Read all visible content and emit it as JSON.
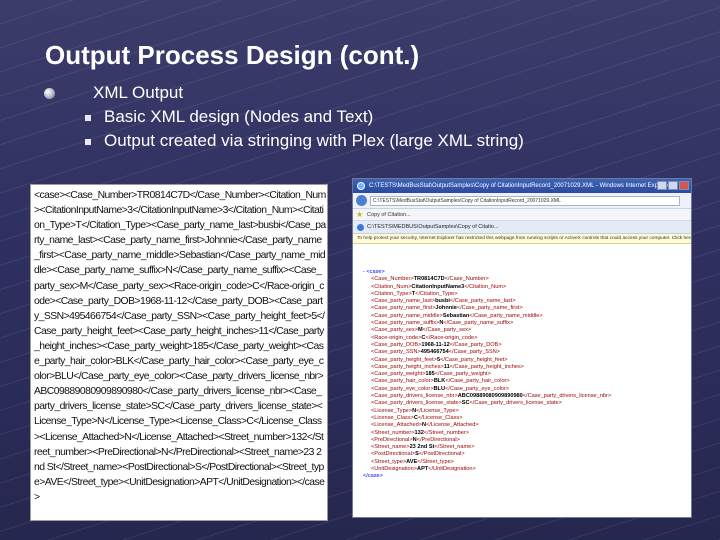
{
  "slide": {
    "title": "Output Process Design (cont.)",
    "bullets": [
      {
        "level": 1,
        "text": "XML Output"
      },
      {
        "level": 2,
        "text": "Basic XML design (Nodes and Text)"
      },
      {
        "level": 2,
        "text": "Output created via stringing with Plex (large XML string)"
      }
    ]
  },
  "raw_xml": {
    "text": "<case><Case_Number>TR0814C7D</Case_Number><Citation_Num><CitationInputName>3</CitationInputName>3</Citation_Num><Citation_Type>T</Citation_Type><Case_party_name_last>busbi</Case_party_name_last><Case_party_name_first>Johnnie</Case_party_name_first><Case_party_name_middle>Sebastian</Case_party_name_middle><Case_party_name_suffix>N</Case_party_name_suffix><Case_party_sex>M</Case_party_sex><Race-origin_code>C</Race-origin_code><Case_party_DOB>1968-11-12</Case_party_DOB><Case_party_SSN>495466754</Case_party_SSN><Case_party_height_feet>5</Case_party_height_feet><Case_party_height_inches>11</Case_party_height_inches><Case_party_weight>185</Case_party_weight><Case_party_hair_color>BLK</Case_party_hair_color><Case_party_eye_color>BLU</Case_party_eye_color><Case_party_drivers_license_nbr>ABC09889080909890980</Case_party_drivers_license_nbr><Case_party_drivers_license_state>SC</Case_party_drivers_license_state><License_Type>N</License_Type><License_Class>C</License_Class><License_Attached>N</License_Attached><Street_number>132</Street_number><PreDirectional>N</PreDirectional><Street_name>23 2nd St</Street_name><PostDirectional>S</PostDirectional><Street_type>AVE</Street_type><UnitDesignation>APT</UnitDesignation></case>"
  },
  "browser": {
    "window_title": "C:\\TESTS\\MedBusStat\\OutputSamples\\Copy of CitationInputRecord_20071029.XML - Windows Internet Explorer",
    "address": "C:\\TESTS\\MedBusStat\\OutputSamples\\Copy of CitationInputRecord_20071029.XML",
    "tab_label": "Copy of Citation...",
    "second_window_title": "C:\\TESTS\\MEDBUS\\OutputSamples\\Copy of Citatio...",
    "infobar": "To help protect your security, Internet Explorer has restricted this webpage from running scripts or ActiveX controls that could access your computer. Click here for options...",
    "xml_root_open": "- <case>",
    "xml_root_close": "</case>",
    "xml_lines": [
      {
        "tag": "Case_Number",
        "value": "TR0814C7D"
      },
      {
        "tag": "Citation_Num",
        "value": "CitationInputName3"
      },
      {
        "tag": "Citation_Type",
        "value": "T"
      },
      {
        "tag": "Case_party_name_last",
        "value": "busbi"
      },
      {
        "tag": "Case_party_name_first",
        "value": "Johnnie"
      },
      {
        "tag": "Case_party_name_middle",
        "value": "Sebastian"
      },
      {
        "tag": "Case_party_name_suffix",
        "value": "N"
      },
      {
        "tag": "Case_party_sex",
        "value": "M"
      },
      {
        "tag": "Race-origin_code",
        "value": "C"
      },
      {
        "tag": "Case_party_DOB",
        "value": "1968-11-12"
      },
      {
        "tag": "Case_party_SSN",
        "value": "495466754"
      },
      {
        "tag": "Case_party_height_feet",
        "value": "5"
      },
      {
        "tag": "Case_party_height_inches",
        "value": "11"
      },
      {
        "tag": "Case_party_weight",
        "value": "185"
      },
      {
        "tag": "Case_party_hair_color",
        "value": "BLK"
      },
      {
        "tag": "Case_party_eye_color",
        "value": "BLU"
      },
      {
        "tag": "Case_party_drivers_license_nbr",
        "value": "ABC09889080909890980"
      },
      {
        "tag": "Case_party_drivers_license_state",
        "value": "SC"
      },
      {
        "tag": "License_Type",
        "value": "N"
      },
      {
        "tag": "License_Class",
        "value": "C"
      },
      {
        "tag": "License_Attached",
        "value": "N"
      },
      {
        "tag": "Street_number",
        "value": "132"
      },
      {
        "tag": "PreDirectional",
        "value": "N"
      },
      {
        "tag": "Street_name",
        "value": "23 2nd St"
      },
      {
        "tag": "PostDirectional",
        "value": "S"
      },
      {
        "tag": "Street_type",
        "value": "AVE"
      },
      {
        "tag": "UnitDesignation",
        "value": "APT"
      }
    ]
  }
}
